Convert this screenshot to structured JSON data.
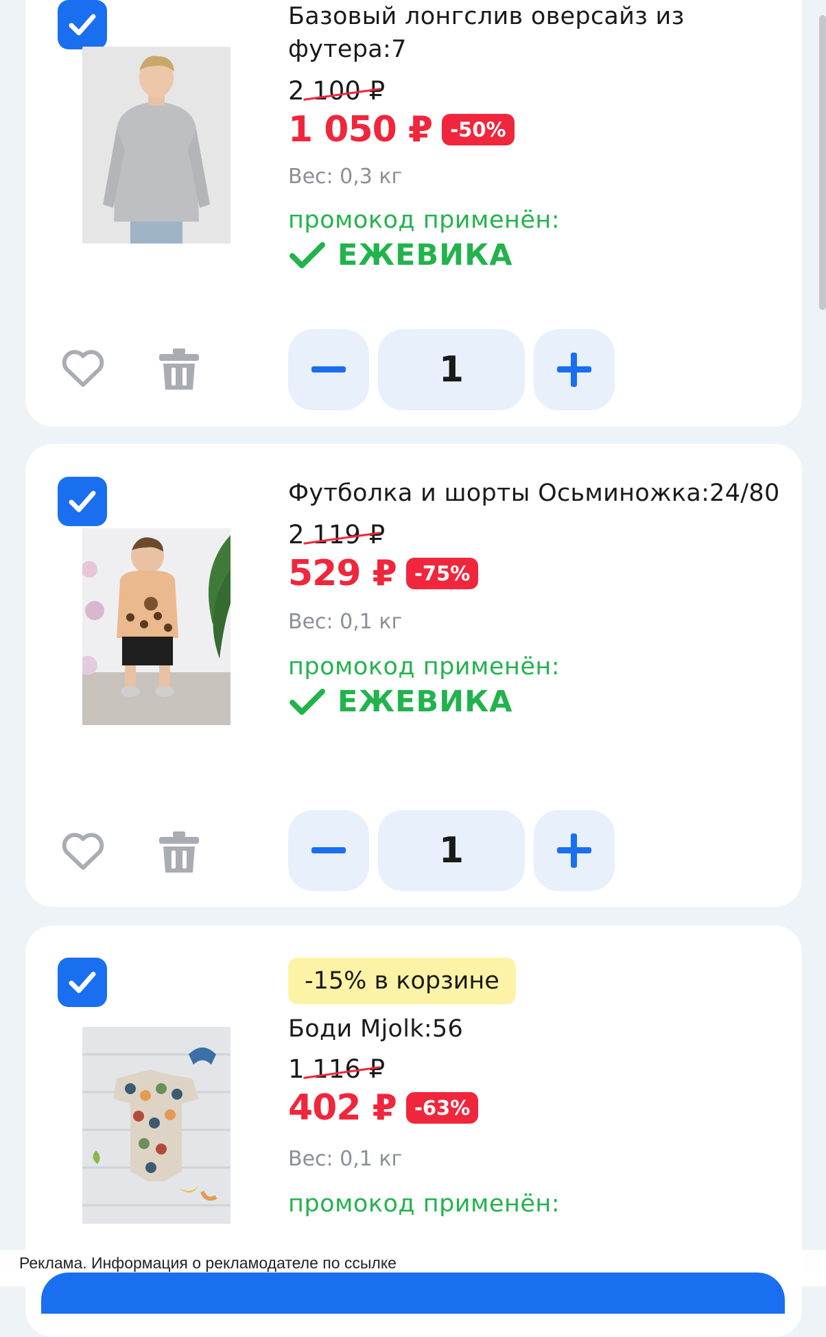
{
  "colors": {
    "accent": "#1a6ef0",
    "price_red": "#f0263c",
    "promo_green": "#22b34c",
    "basket_badge_bg": "#fdf3a6",
    "stepper_bg": "#e7f0fb"
  },
  "icons": {
    "checkbox": "checkmark-icon",
    "favorite": "heart-icon",
    "delete": "trash-icon",
    "decrement": "minus-icon",
    "increment": "plus-icon",
    "promo": "checkmark-icon"
  },
  "cart": {
    "items": [
      {
        "checked": true,
        "title": "Базовый лонгслив оверсайз из футера:7",
        "old_price": "2 100 ₽",
        "price": "1 050 ₽",
        "discount": "-50%",
        "weight": "Вес: 0,3 кг",
        "promo_label": "промокод применён:",
        "promo_code": "ЕЖЕВИКА",
        "quantity": "1"
      },
      {
        "checked": true,
        "title": "Футболка и шорты Осьминожка:24/80",
        "old_price": "2 119 ₽",
        "price": "529 ₽",
        "discount": "-75%",
        "weight": "Вес: 0,1 кг",
        "promo_label": "промокод применён:",
        "promo_code": "ЕЖЕВИКА",
        "quantity": "1"
      },
      {
        "checked": true,
        "basket_badge": "-15% в корзине",
        "title": "Боди Mjolk:56",
        "old_price": "1 116 ₽",
        "price": "402 ₽",
        "discount": "-63%",
        "weight": "Вес: 0,1 кг",
        "promo_label": "промокод применён:"
      }
    ]
  },
  "footer": {
    "ad_text": "Реклама. Информация о рекламодателе по ссылке"
  }
}
